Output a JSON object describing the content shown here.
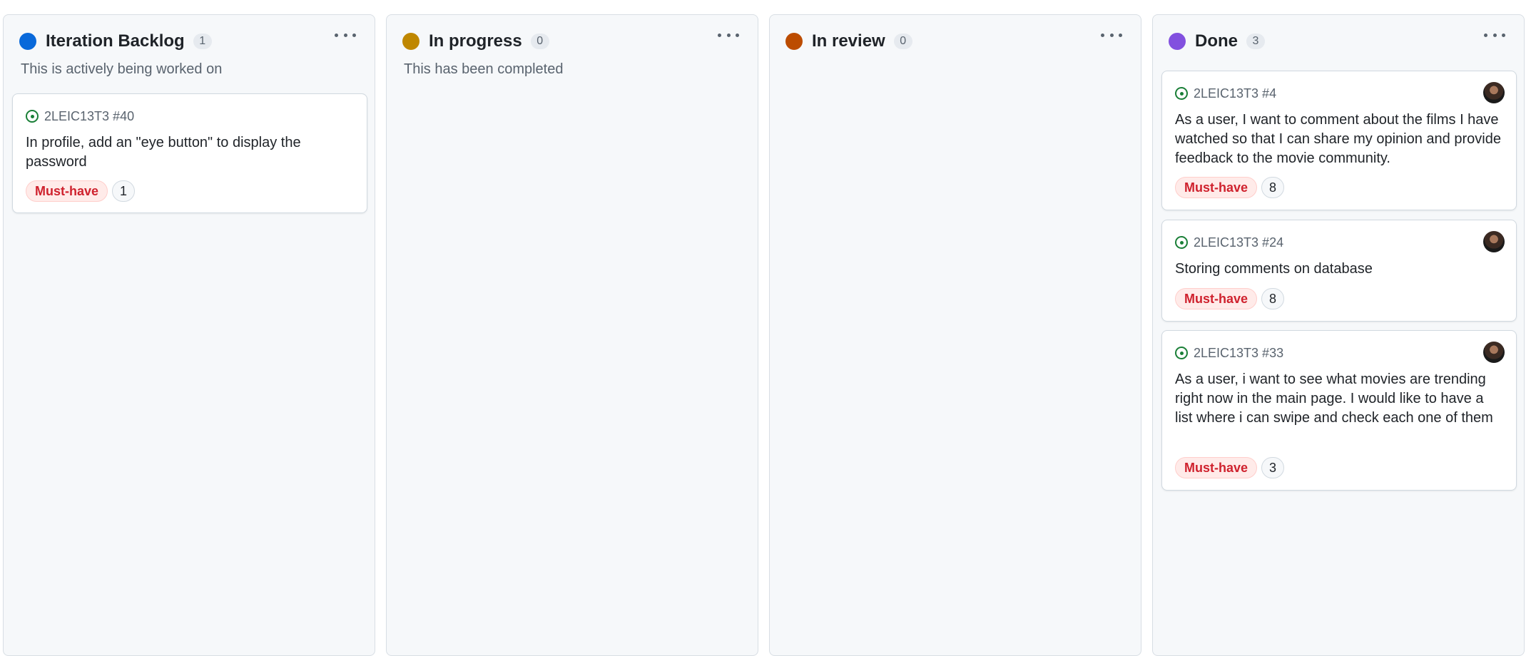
{
  "columns": [
    {
      "title": "Iteration Backlog",
      "count": "1",
      "color": "#0969da",
      "description": "This is actively being worked on",
      "cards": [
        {
          "ref": "2LEIC13T3 #40",
          "title": "In profile, add an \"eye button\" to display the password",
          "label": "Must-have",
          "points": "1",
          "avatar": false
        }
      ]
    },
    {
      "title": "In progress",
      "count": "0",
      "color": "#bf8700",
      "description": "This has been completed",
      "cards": []
    },
    {
      "title": "In review",
      "count": "0",
      "color": "#bc4c00",
      "description": "",
      "cards": []
    },
    {
      "title": "Done",
      "count": "3",
      "color": "#8250df",
      "description": "",
      "cards": [
        {
          "ref": "2LEIC13T3 #4",
          "title": "As a user, I want to comment about the films I have watched so that I can share my opinion and provide feedback to the movie community.",
          "label": "Must-have",
          "points": "8",
          "avatar": true
        },
        {
          "ref": "2LEIC13T3 #24",
          "title": "Storing comments on database",
          "label": "Must-have",
          "points": "8",
          "avatar": true
        },
        {
          "ref": "2LEIC13T3 #33",
          "title": "As a user, i want to see what movies are trending right now in the main page. I would like to have a list where i can swipe and check each one of them",
          "label": "Must-have",
          "points": "3",
          "avatar": true
        }
      ]
    }
  ],
  "icons": {
    "column_menu": "kebab-horizontal-icon",
    "issue_status": "issue-opened-icon"
  }
}
